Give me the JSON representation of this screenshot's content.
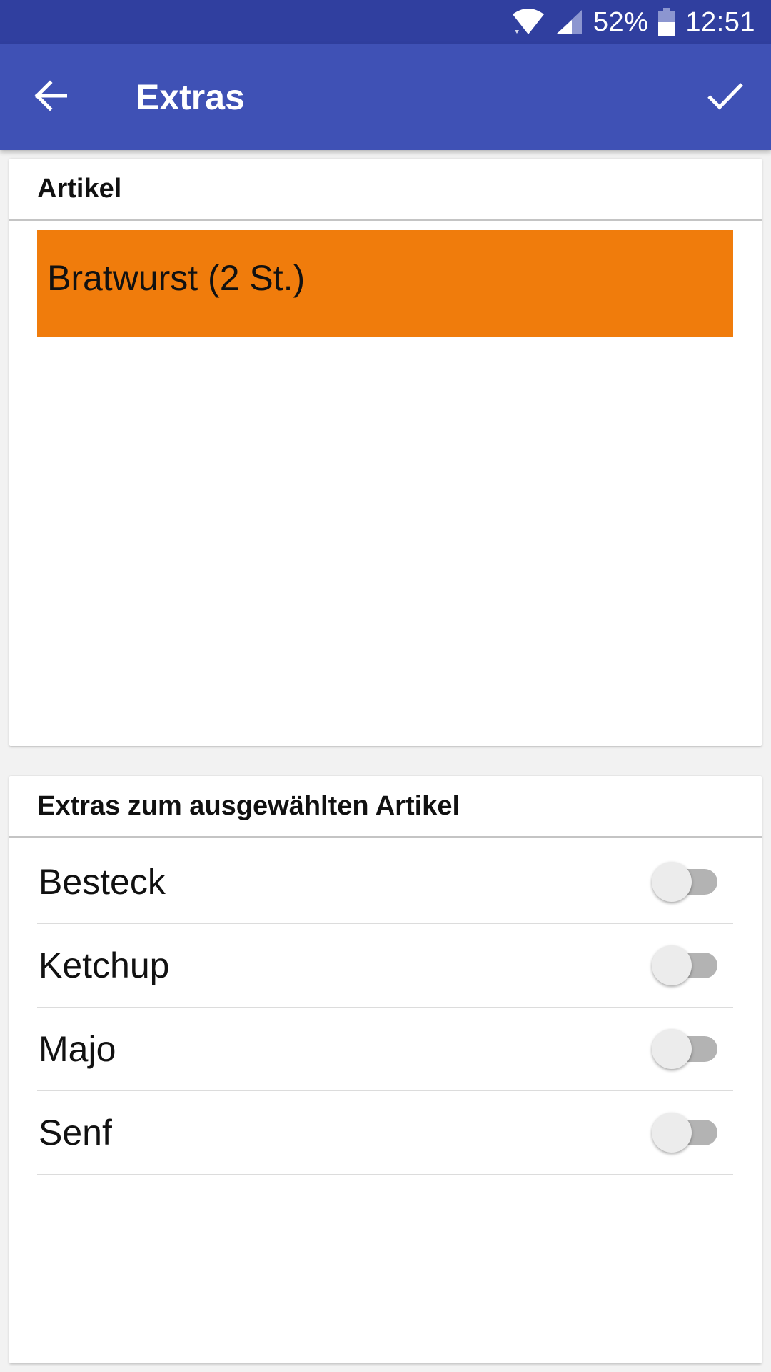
{
  "status_bar": {
    "battery_text": "52%",
    "time": "12:51",
    "icons": [
      "wifi-icon",
      "cell-signal-icon",
      "battery-icon"
    ]
  },
  "app_bar": {
    "title": "Extras",
    "back_icon": "arrow-back-icon",
    "confirm_icon": "check-icon",
    "color": "#3f51b5",
    "status_color": "#303f9f"
  },
  "articles": {
    "header": "Artikel",
    "items": [
      {
        "label": "Bratwurst (2 St.)",
        "selected": true,
        "color": "#f07c0c"
      }
    ]
  },
  "extras": {
    "header": "Extras zum ausgewählten Artikel",
    "items": [
      {
        "label": "Besteck",
        "checked": false
      },
      {
        "label": "Ketchup",
        "checked": false
      },
      {
        "label": "Majo",
        "checked": false
      },
      {
        "label": "Senf",
        "checked": false
      }
    ]
  }
}
